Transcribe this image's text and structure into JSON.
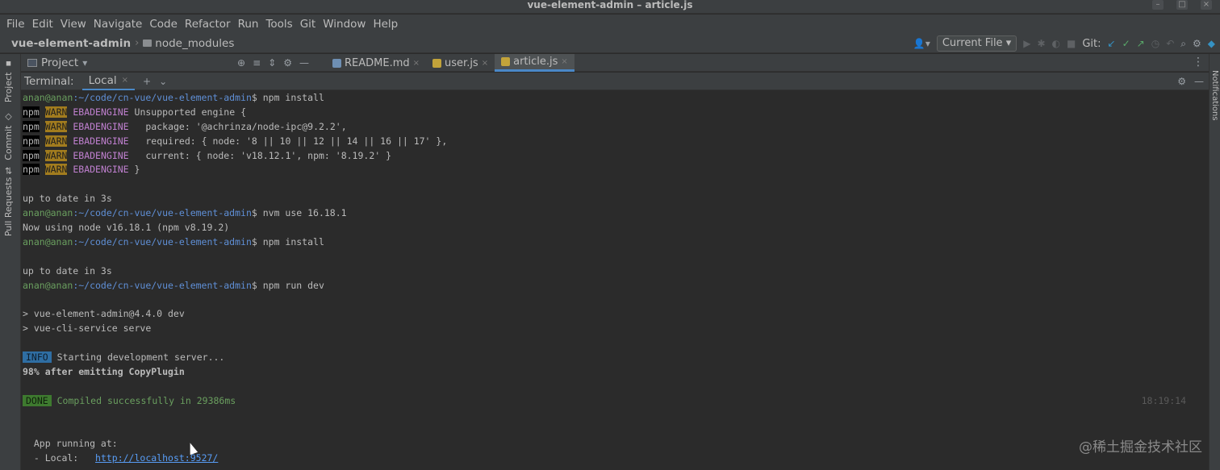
{
  "window": {
    "title": "vue-element-admin – article.js"
  },
  "menu": [
    "File",
    "Edit",
    "View",
    "Navigate",
    "Code",
    "Refactor",
    "Run",
    "Tools",
    "Git",
    "Window",
    "Help"
  ],
  "nav": {
    "project": "vue-element-admin",
    "folder": "node_modules",
    "run_config": "Current File",
    "git_label": "Git:"
  },
  "sidebar": {
    "project": "Project",
    "commit": "Commit",
    "pull_requests": "Pull Requests",
    "notifications": "Notifications"
  },
  "project_panel": {
    "label": "Project"
  },
  "editor_tabs": [
    {
      "label": "README.md"
    },
    {
      "label": "user.js"
    },
    {
      "label": "article.js"
    }
  ],
  "terminal": {
    "label": "Terminal:",
    "tab": "Local",
    "prompt_user": "anan@anan",
    "prompt_path": ":~/code/cn-vue/vue-element-admin",
    "cmd_install": "$ npm install",
    "cmd_nvm": "$ nvm use 16.18.1",
    "cmd_dev": "$ npm run dev",
    "npm": "npm",
    "warn": "WARN",
    "warn_code": "EBADENGINE",
    "warn_lines": [
      " Unsupported engine {",
      "   package: '@achrinza/node-ipc@9.2.2',",
      "   required: { node: '8 || 10 || 12 || 14 || 16 || 17' },",
      "   current: { node: 'v18.12.1', npm: '8.19.2' }",
      " }"
    ],
    "up_to_date": "up to date in 3s",
    "now_using": "Now using node v16.18.1 (npm v8.19.2)",
    "script_line1": "> vue-element-admin@4.4.0 dev",
    "script_line2": "> vue-cli-service serve",
    "info_tag": "INFO",
    "info_text": " Starting development server...",
    "progress": "98% after emitting CopyPlugin",
    "done_tag": "DONE",
    "done_text": " Compiled successfully in 29386ms",
    "timestamp": "18:19:14",
    "app_running": "  App running at:",
    "local_label": "  - Local:   ",
    "local_url": "http://localhost:9527/"
  },
  "watermark": "@稀土掘金技术社区"
}
